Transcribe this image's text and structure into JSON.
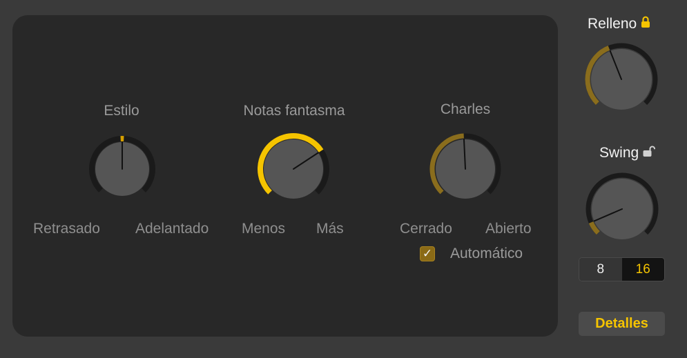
{
  "main": {
    "style_knob": {
      "title": "Estilo",
      "left_label": "Retrasado",
      "right_label": "Adelantado",
      "value_fraction": 0.5,
      "fill_color": "#d6a000"
    },
    "ghost_notes_knob": {
      "title": "Notas fantasma",
      "left_label": "Menos",
      "right_label": "Más",
      "value_fraction": 0.71,
      "fill_color": "#f5c400"
    },
    "hihat_knob": {
      "title": "Charles",
      "left_label": "Cerrado",
      "right_label": "Abierto",
      "value_fraction": 0.49,
      "fill_color": "#8a6d1d",
      "auto_checkbox": {
        "label": "Automático",
        "checked": true
      }
    }
  },
  "side": {
    "fill_knob": {
      "title": "Relleno",
      "locked": true,
      "lock_icon": "lock-closed-icon",
      "value_fraction": 0.42,
      "fill_color": "#8a6d1d"
    },
    "swing_knob": {
      "title": "Swing",
      "locked": false,
      "lock_icon": "lock-open-icon",
      "value_fraction": 0.08,
      "fill_color": "#8a6d1d"
    },
    "resolution": {
      "options": [
        "8",
        "16"
      ],
      "selected": "16"
    },
    "details_label": "Detalles"
  },
  "colors": {
    "accent": "#f5c400",
    "track": "#1a1a1a",
    "knob_face": "#555555"
  }
}
